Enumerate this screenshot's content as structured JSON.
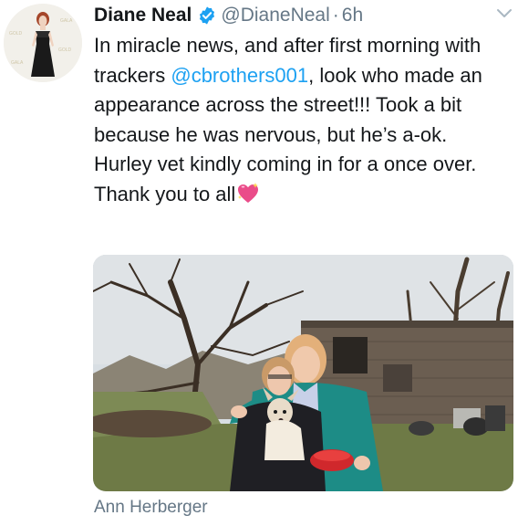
{
  "author": {
    "display_name": "Diane Neal",
    "handle": "@DianeNeal",
    "separator": "·",
    "timestamp": "6h",
    "verified": true
  },
  "tweet": {
    "text_part1": "In miracle news, and after first morning with trackers ",
    "mention": "@cbrothers001",
    "text_part2": ", look who made an appearance across the street!!! Took a bit because he was nervous, but he’s a-ok. Hurley vet kindly coming in for a once over. Thank you to all",
    "emoji": "sparkling-heart"
  },
  "media": {
    "photo_credit": "Ann Herberger"
  },
  "colors": {
    "text": "#14171a",
    "secondary": "#657786",
    "link": "#1da1f2",
    "verified_badge": "#1da1f2"
  }
}
